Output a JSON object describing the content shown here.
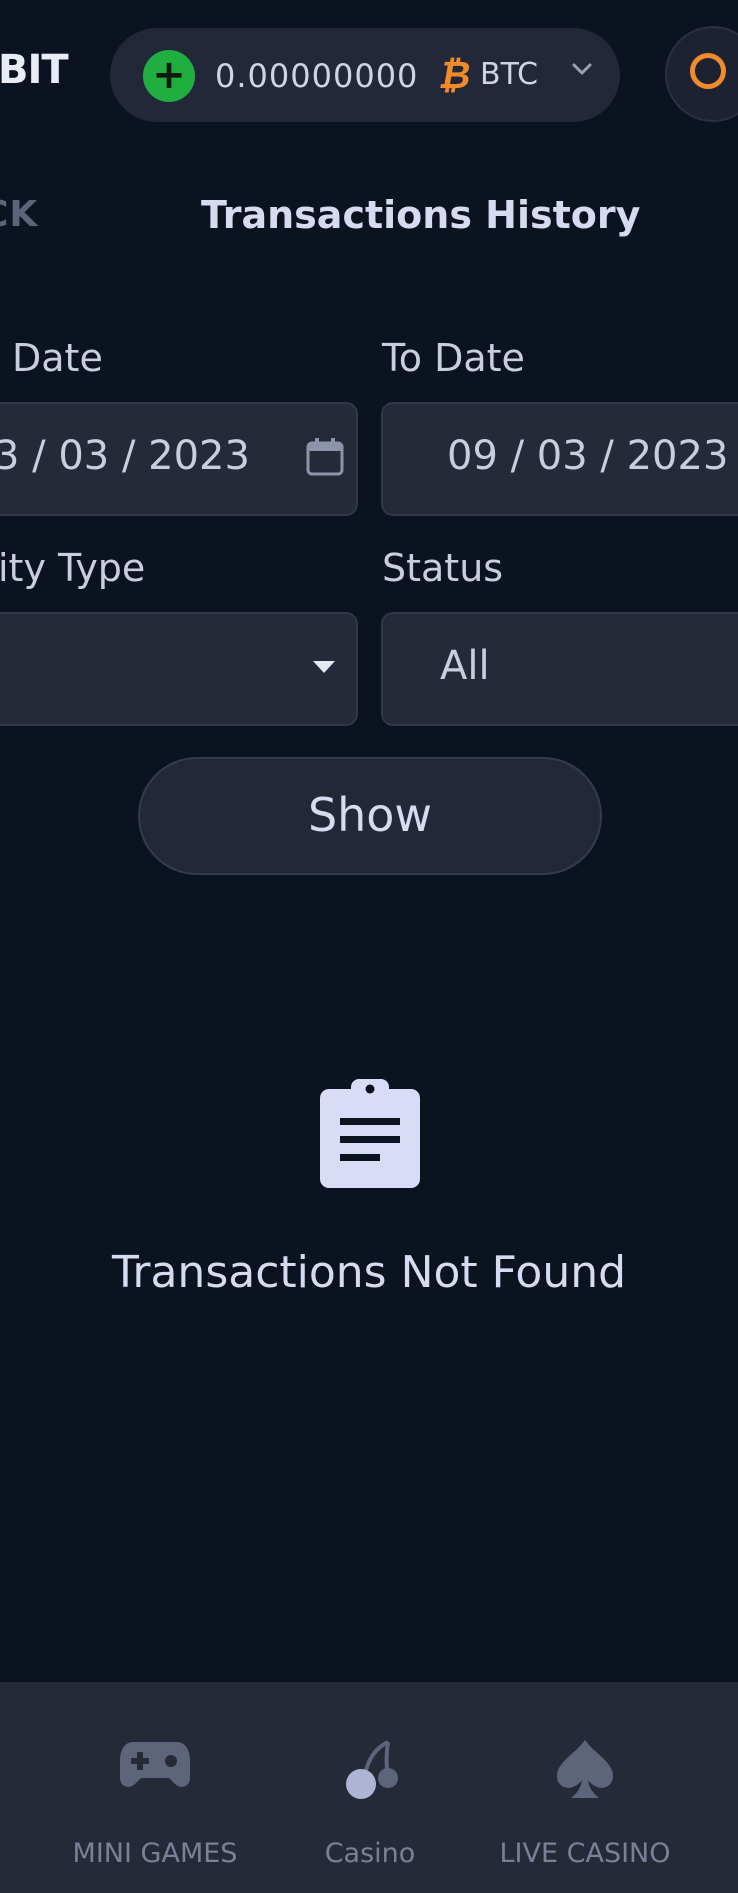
{
  "header": {
    "logo_text": "BIT",
    "balance": "0.00000000",
    "currency_symbol": "₿",
    "currency": "BTC"
  },
  "nav": {
    "back_label": "CK",
    "title": "Transactions History"
  },
  "filters": {
    "from_date_label": "Date",
    "from_date_value": "3 / 03 / 2023",
    "to_date_label": "To Date",
    "to_date_value": "09 / 03 / 2023",
    "activity_type_label": "ity Type",
    "activity_type_value": "",
    "status_label": "Status",
    "status_value": "All",
    "show_label": "Show"
  },
  "empty_state": {
    "message": "Transactions Not Found"
  },
  "bottom_nav": {
    "items": [
      {
        "label": "MINI GAMES",
        "icon": "gamepad-icon"
      },
      {
        "label": "Casino",
        "icon": "cherry-icon"
      },
      {
        "label": "LIVE CASINO",
        "icon": "spade-icon"
      }
    ]
  },
  "colors": {
    "background": "#0c1320",
    "panel": "#252a39",
    "accent_green": "#1fae3f",
    "accent_orange": "#f08a2a"
  }
}
